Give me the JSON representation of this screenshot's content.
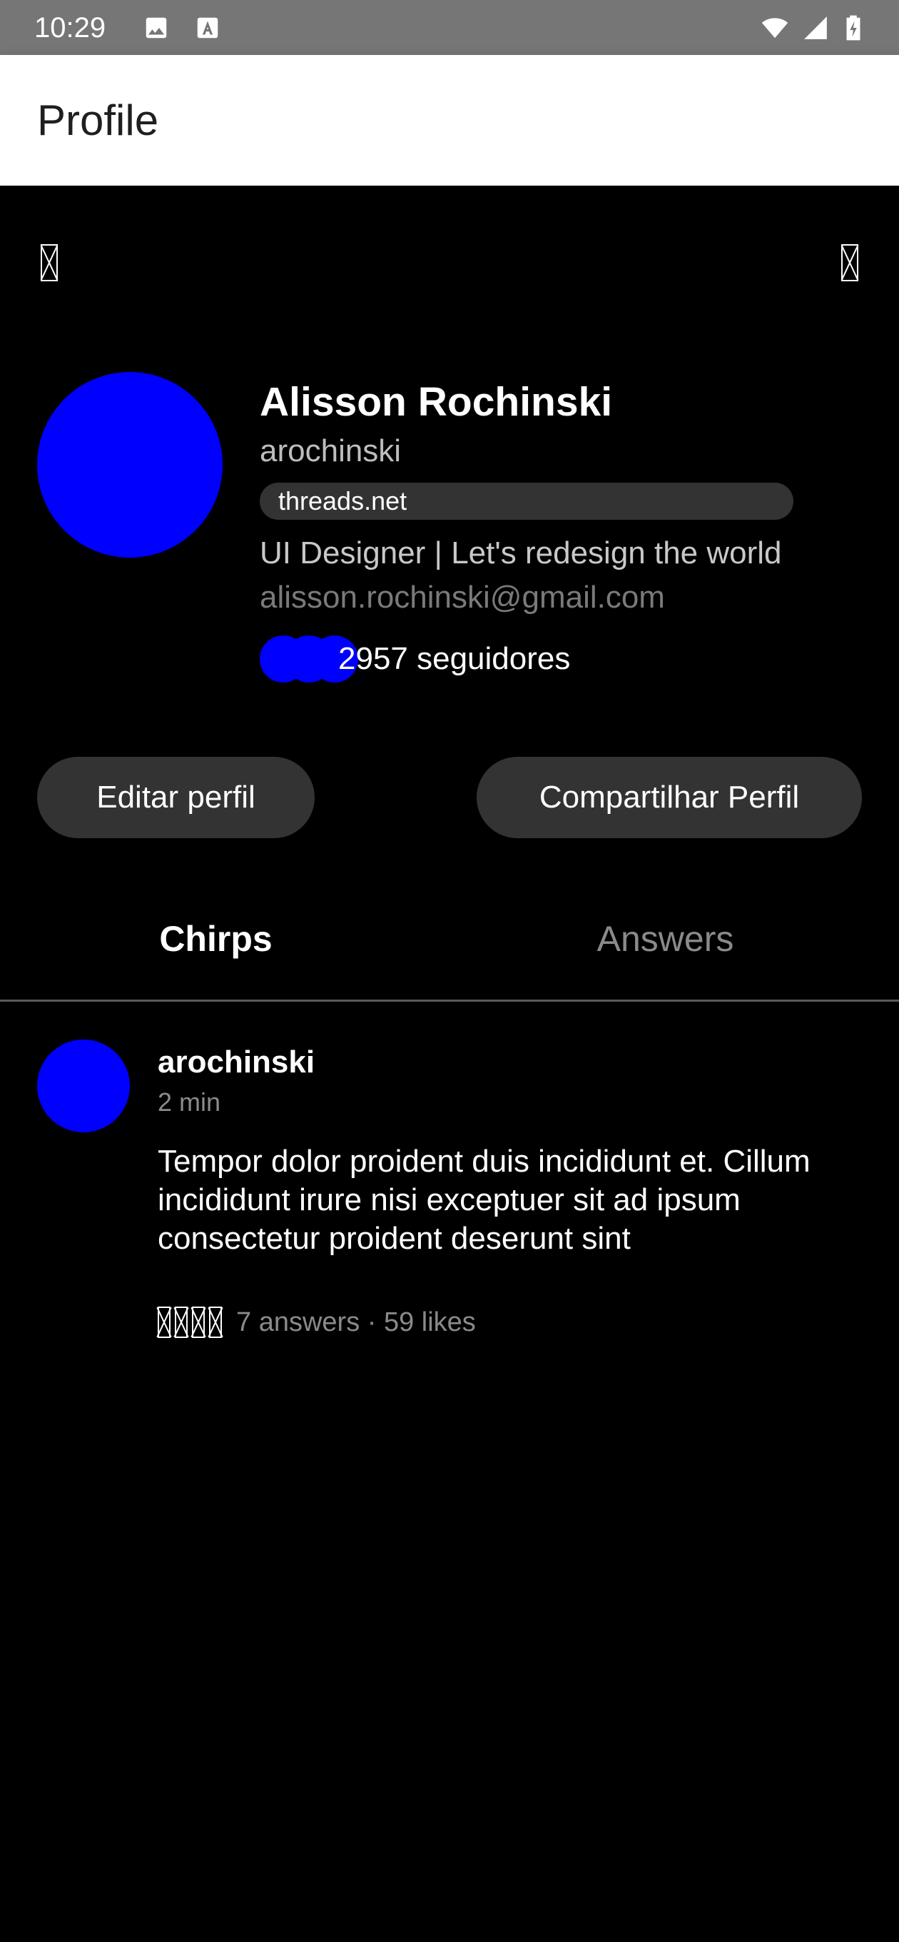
{
  "status_bar": {
    "time": "10:29",
    "left_icons": [
      "image-icon",
      "text-a-icon"
    ],
    "right_icons": [
      "wifi-icon",
      "signal-icon",
      "battery-charging-icon"
    ]
  },
  "app_bar": {
    "title": "Profile"
  },
  "header_icons": {
    "left": "missing-glyph-icon",
    "right": "missing-glyph-icon"
  },
  "profile": {
    "name": "Alisson Rochinski",
    "username": "arochinski",
    "link": "threads.net",
    "bio": "UI Designer | Let's redesign the world",
    "email": "alisson.rochinski@gmail.com",
    "followers_text": "2957 seguidores",
    "avatar_color": "#0000ff"
  },
  "actions": {
    "edit": "Editar perfil",
    "share": "Compartilhar Perfil"
  },
  "tabs": [
    {
      "label": "Chirps",
      "active": true
    },
    {
      "label": "Answers",
      "active": false
    }
  ],
  "posts": [
    {
      "username": "arochinski",
      "time": "2 min",
      "body": "Tempor dolor proident duis incididunt et. Cillum incididunt irure nisi exceptuer sit ad ipsum consectetur proident deserunt sint",
      "meta": "7 answers · 59 likes",
      "action_icons": [
        "like-icon",
        "comment-icon",
        "repost-icon",
        "share-icon"
      ]
    }
  ],
  "colors": {
    "background": "#000000",
    "status_bar": "#767676",
    "app_bar": "#ffffff",
    "button_bg": "#333333",
    "accent": "#0000ff"
  }
}
